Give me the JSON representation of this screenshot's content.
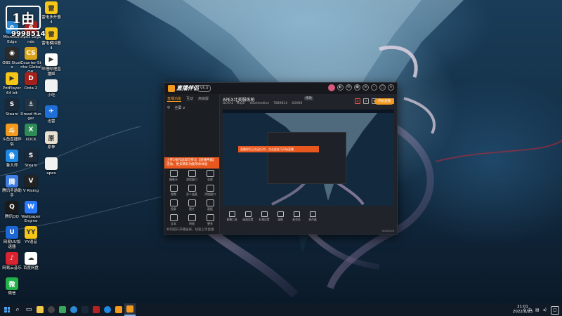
{
  "overlay": {
    "logo_text": "1由",
    "number": "9998514"
  },
  "desktop_icons": [
    {
      "label": "Microsoft Edge",
      "icon": "edge-icon",
      "color": "#2a8bd8",
      "glyph": "e"
    },
    {
      "label": "OBS Studio",
      "icon": "obs-icon",
      "color": "#2b2b2b",
      "glyph": "◉"
    },
    {
      "label": "PotPlayer 64 bit",
      "icon": "potplayer-icon",
      "color": "#f5c518",
      "glyph": "▶"
    },
    {
      "label": "Steam",
      "icon": "steam-icon",
      "color": "#1b2838",
      "glyph": "S"
    },
    {
      "label": "斗鱼直播伴侣",
      "icon": "douyu-icon",
      "color": "#f39a1e",
      "glyph": "斗"
    },
    {
      "label": "鲁大师",
      "icon": "ludashi-icon",
      "color": "#1e88e5",
      "glyph": "鲁"
    },
    {
      "label": "腾讯手游助手",
      "icon": "tencent-gamebox-icon",
      "color": "#3d7de0",
      "glyph": "腾"
    },
    {
      "label": "腾讯QQ",
      "icon": "qq-icon",
      "color": "#1a1a1a",
      "glyph": "Q"
    },
    {
      "label": "网易UU加速器",
      "icon": "uu-icon",
      "color": "#1c66d6",
      "glyph": "U"
    },
    {
      "label": "网易云音乐",
      "icon": "netease-music-icon",
      "color": "#d9232e",
      "glyph": "♪"
    },
    {
      "label": "微信",
      "icon": "wechat-icon",
      "color": "#22b04a",
      "glyph": "微"
    }
  ],
  "desktop_icons_col2": [
    {
      "label": "Apex Legends",
      "icon": "apex-icon",
      "color": "#b22222",
      "glyph": "A"
    },
    {
      "label": "Counter-Strike Global Off.",
      "icon": "csgo-icon",
      "color": "#d9a21b",
      "glyph": "CS"
    },
    {
      "label": "Dota 2",
      "icon": "dota-icon",
      "color": "#a3201b",
      "glyph": "D"
    },
    {
      "label": "Dread Hunger",
      "icon": "dread-hunger-icon",
      "color": "#223344",
      "glyph": "⚓"
    },
    {
      "label": "XDCK",
      "icon": "xdck-icon",
      "color": "#2e8b57",
      "glyph": "X"
    },
    {
      "label": "Steam",
      "icon": "steam-icon-2",
      "color": "#1b2838",
      "glyph": "S"
    },
    {
      "label": "V Rising",
      "icon": "vrising-icon",
      "color": "#222",
      "glyph": "V"
    },
    {
      "label": "Wallpaper Engine",
      "icon": "wallpaper-engine-icon",
      "color": "#2979ff",
      "glyph": "W"
    },
    {
      "label": "YY语音",
      "icon": "yy-icon",
      "color": "#f5c518",
      "glyph": "YY"
    },
    {
      "label": "百度网盘",
      "icon": "baidu-netdisk-icon",
      "color": "#fff",
      "glyph": "☁"
    }
  ],
  "desktop_icons_col3": [
    {
      "label": "雷电多开器4",
      "icon": "leidian-multi-icon",
      "color": "#f5c518",
      "glyph": "雷"
    },
    {
      "label": "雷电模拟器4",
      "icon": "leidian-icon",
      "color": "#f5c518",
      "glyph": "雷"
    },
    {
      "label": "哔哩哔哩直播姬",
      "icon": "bilibili-live-icon",
      "color": "#fff",
      "glyph": "▶"
    },
    {
      "label": "小吃",
      "icon": "file-icon-1",
      "color": "#f2f2f2",
      "glyph": ""
    },
    {
      "label": "迅雷",
      "icon": "xunlei-icon",
      "color": "#1e6fd8",
      "glyph": "✈"
    },
    {
      "label": "原神",
      "icon": "genshin-icon",
      "color": "#e8e0d0",
      "glyph": "原"
    },
    {
      "label": "apex",
      "icon": "file-icon-2",
      "color": "#f2f2f2",
      "glyph": ""
    }
  ],
  "app": {
    "brand": "直播伴侣",
    "version_badge": "V5.0",
    "left_tabs": [
      "直播功能",
      "互动",
      "高级版"
    ],
    "left_sub": [
      "◎",
      "全屏 ∨"
    ],
    "banner_text": "上传3张作品即可参与【直播神器】活动，更多精彩功能等你体验",
    "tools": [
      {
        "label": "摄像头",
        "icon": "camera-icon"
      },
      {
        "label": "游戏窗口",
        "icon": "game-window-icon"
      },
      {
        "label": "全屏",
        "icon": "fullscreen-icon"
      },
      {
        "label": "视频",
        "icon": "video-icon"
      },
      {
        "label": "多人连麦",
        "icon": "multi-mic-icon"
      },
      {
        "label": "添加窗口",
        "icon": "add-window-icon"
      },
      {
        "label": "投屏",
        "icon": "cast-icon"
      },
      {
        "label": "图片",
        "icon": "image-icon"
      },
      {
        "label": "画板",
        "icon": "board-icon"
      },
      {
        "label": "文本",
        "icon": "text-icon"
      },
      {
        "label": "特效",
        "icon": "effect-icon"
      },
      {
        "label": "更多",
        "icon": "more-icon"
      }
    ],
    "footer": "如何提升开播画质，快速上手直播",
    "room_title": "APEX北美服练枪",
    "room_badge": "修改",
    "room_meta": [
      "DOTA2 · Major",
      "Yourtimeline",
      "7889814",
      "4GX66"
    ],
    "bottom_tools": [
      {
        "label": "直播工具",
        "icon": "live-tools-icon"
      },
      {
        "label": "画面设置",
        "icon": "screen-settings-icon"
      },
      {
        "label": "礼物设置",
        "icon": "gift-settings-icon"
      },
      {
        "label": "录像",
        "icon": "record-icon"
      },
      {
        "label": "麦克风",
        "icon": "mic-icon"
      },
      {
        "label": "扬声器",
        "icon": "speaker-icon"
      }
    ],
    "start_live": "开始直播",
    "status_line": "00:00:00"
  },
  "preview": {
    "nested_banner": "直播伴侣正在运行中，点击此处可开始直播"
  },
  "taskbar": {
    "time": "21:01",
    "date": "2022/8/23",
    "tray_text": "^  中",
    "accent": "#7bb3ea"
  }
}
